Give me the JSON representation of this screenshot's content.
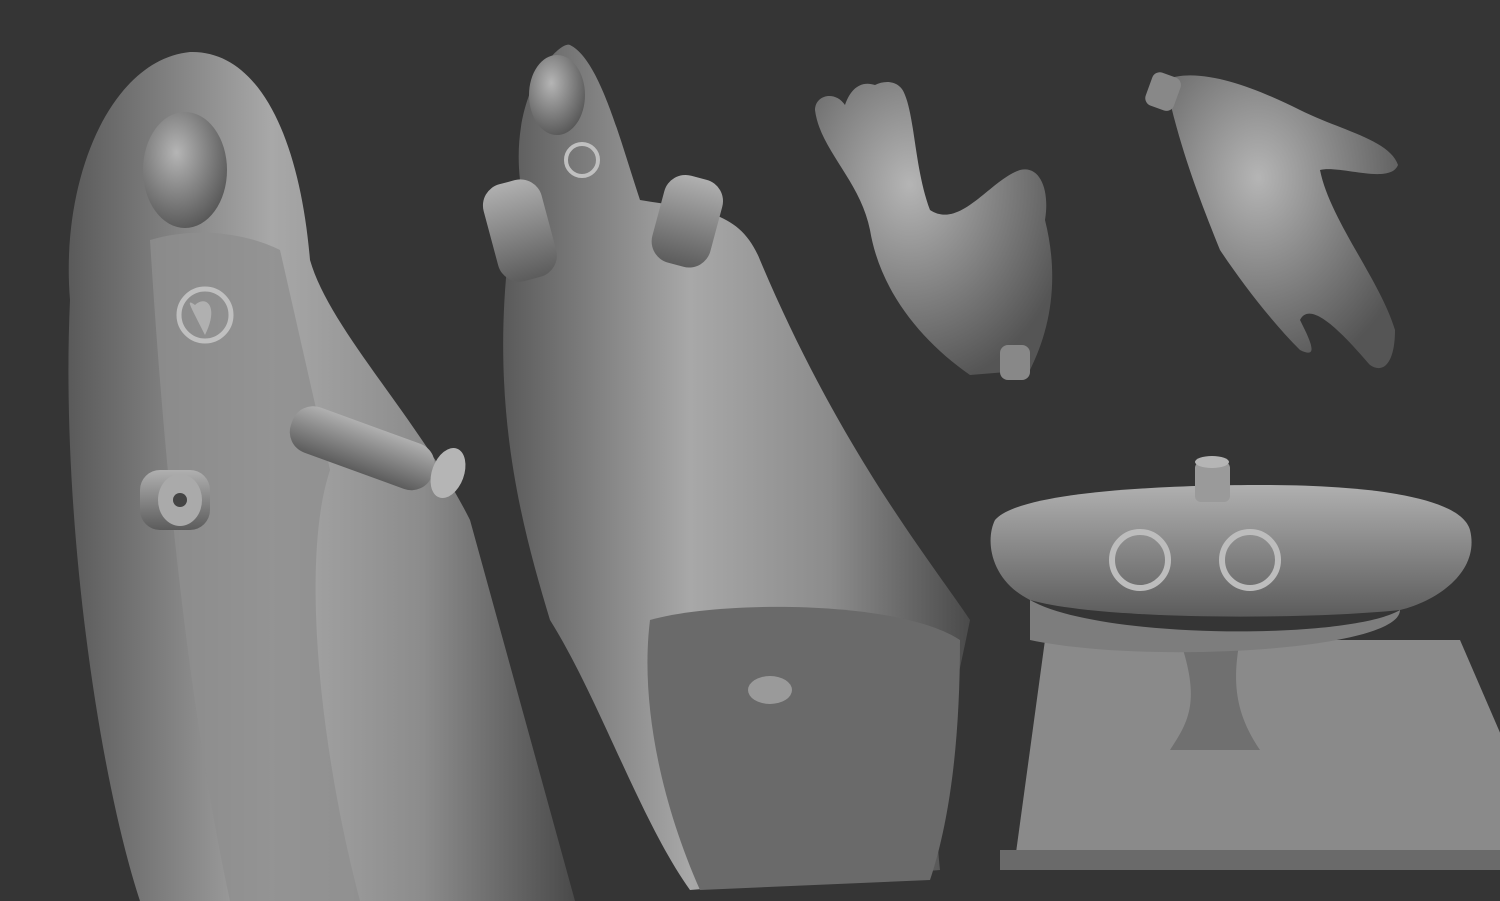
{
  "scene": {
    "background_color": "#353535",
    "material_color": "#9a9a9a",
    "objects": [
      {
        "name": "statue-front-view"
      },
      {
        "name": "statue-top-view"
      },
      {
        "name": "left-hand"
      },
      {
        "name": "right-hand"
      },
      {
        "name": "pedestal-base"
      }
    ]
  }
}
